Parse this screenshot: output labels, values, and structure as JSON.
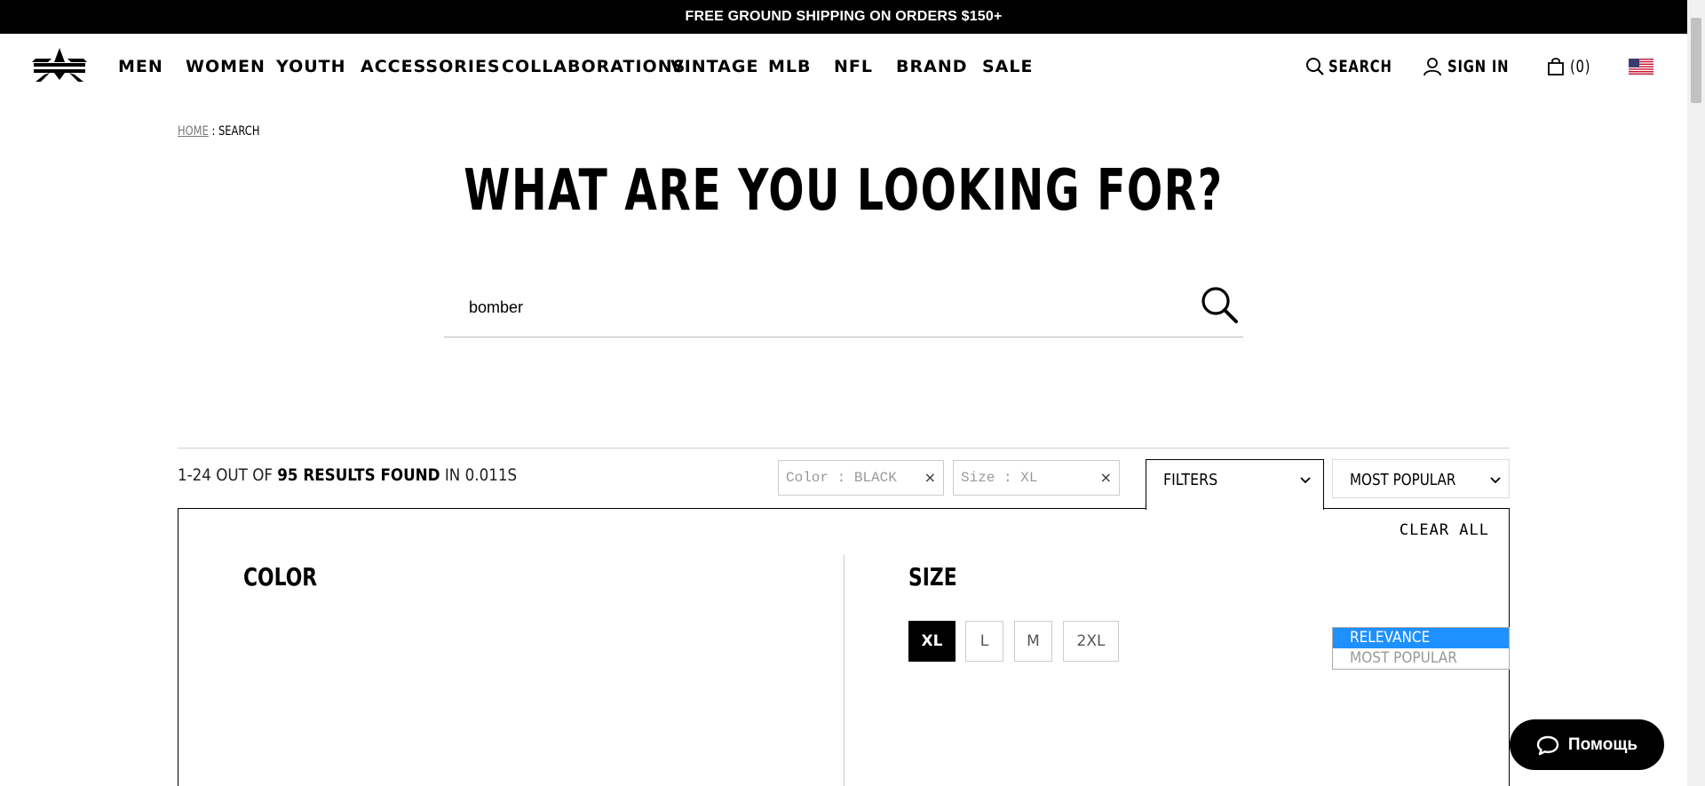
{
  "topbar": {
    "promo": "FREE GROUND SHIPPING ON ORDERS $150+"
  },
  "nav": {
    "items": [
      "MEN",
      "WOMEN",
      "YOUTH",
      "ACCESSORIES",
      "COLLABORATIONS",
      "VINTAGE",
      "MLB",
      "NFL",
      "BRAND",
      "SALE"
    ]
  },
  "utility": {
    "search_label": "SEARCH",
    "signin_label": "SIGN IN",
    "cart_count": "(0)"
  },
  "breadcrumb": {
    "home": "HOME",
    "separator": " : ",
    "current": "SEARCH"
  },
  "page": {
    "title": "WHAT ARE YOU LOOKING FOR?"
  },
  "search": {
    "value": "bomber"
  },
  "results": {
    "range": "1-24 OUT OF",
    "count_text": "95 RESULTS FOUND",
    "time_text": "IN 0.011S"
  },
  "active_filters": [
    {
      "label": "Color : BLACK",
      "remove": "×"
    },
    {
      "label": "Size : XL",
      "remove": "×"
    }
  ],
  "filters_button": {
    "label": "FILTERS"
  },
  "sort": {
    "selected": "MOST POPULAR",
    "options": [
      {
        "label": "RELEVANCE",
        "state": "highlighted"
      },
      {
        "label": "MOST POPULAR",
        "state": "muted"
      }
    ]
  },
  "filter_panel": {
    "clear_all": "CLEAR ALL",
    "color_heading": "COLOR",
    "size_heading": "SIZE",
    "sizes": [
      {
        "label": "XL",
        "selected": true
      },
      {
        "label": "L",
        "selected": false
      },
      {
        "label": "M",
        "selected": false
      },
      {
        "label": "2XL",
        "selected": false
      }
    ]
  },
  "help": {
    "label": "Помощь"
  },
  "colors": {
    "highlight": "#1e90ff",
    "black": "#000000",
    "border": "#cccccc"
  }
}
